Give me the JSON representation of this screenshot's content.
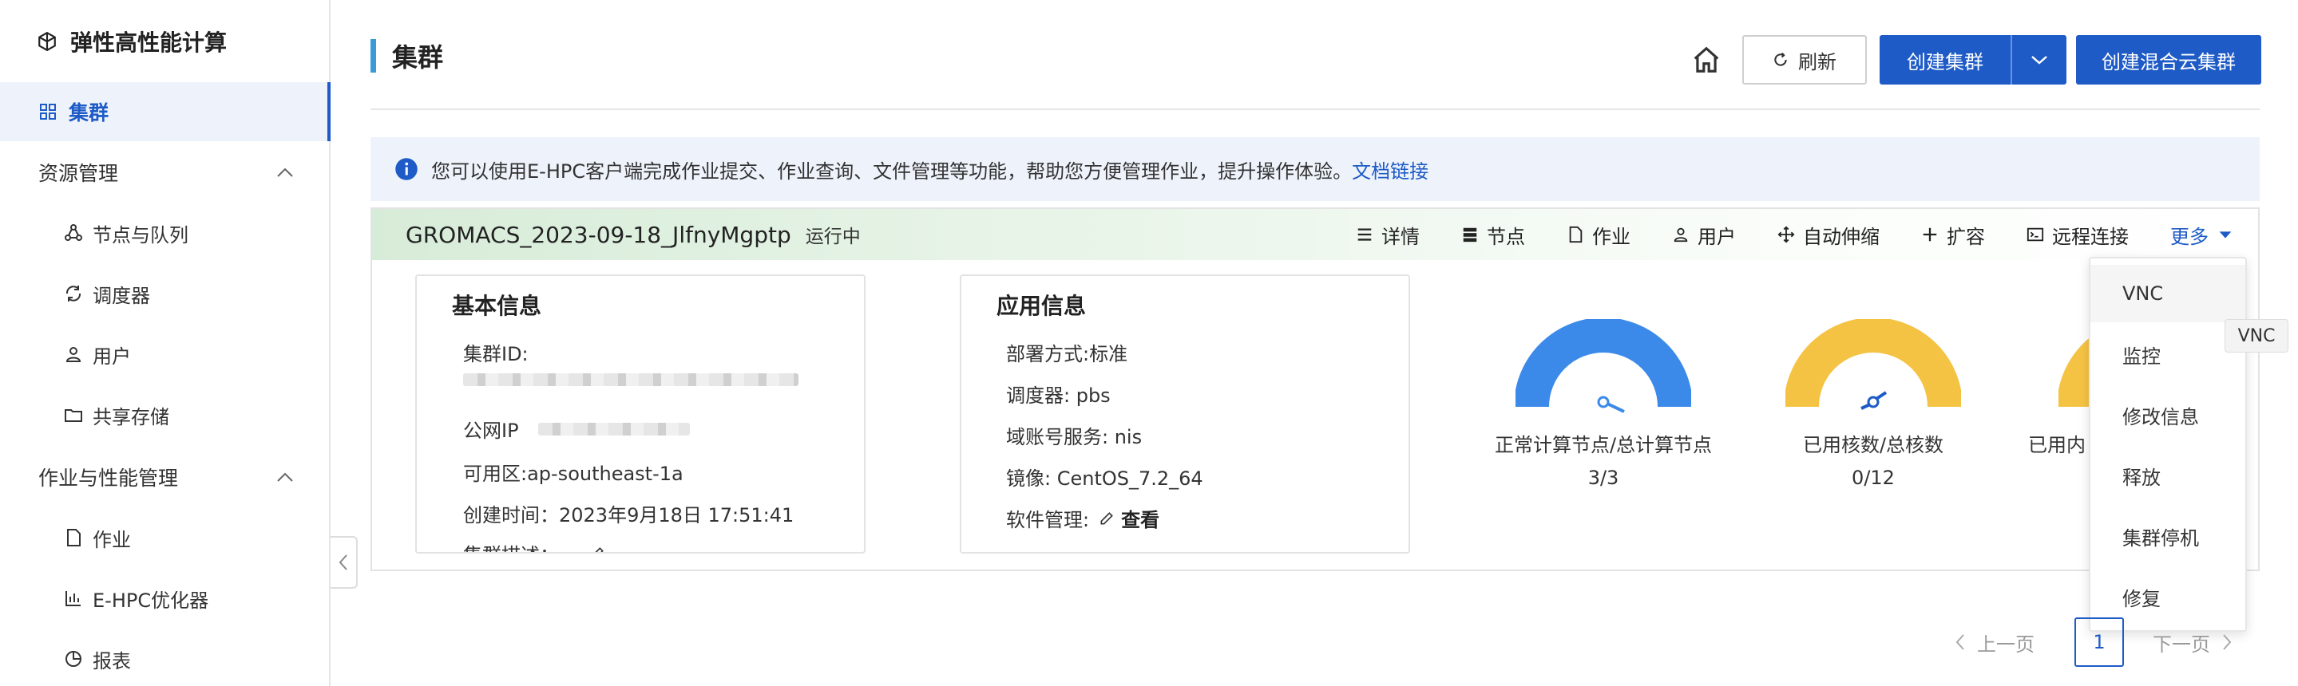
{
  "sidebar": {
    "brand": "弹性高性能计算",
    "active_item": "集群",
    "groups": [
      {
        "label": "资源管理",
        "items": [
          "节点与队列",
          "调度器",
          "用户",
          "共享存储"
        ]
      },
      {
        "label": "作业与性能管理",
        "items": [
          "作业",
          "E-HPC优化器",
          "报表"
        ]
      }
    ]
  },
  "header": {
    "title": "集群",
    "refresh_label": "刷新",
    "create_label": "创建集群",
    "hybrid_label": "创建混合云集群"
  },
  "banner": {
    "text": "您可以使用E-HPC客户端完成作业提交、作业查询、文件管理等功能，帮助您方便管理作业，提升操作体验。",
    "link": "文档链接"
  },
  "cluster": {
    "name": "GROMACS_2023-09-18_JlfnyMgptp",
    "status": "运行中",
    "actions": [
      "详情",
      "节点",
      "作业",
      "用户",
      "自动伸缩",
      "扩容",
      "远程连接",
      "更多"
    ],
    "basic": {
      "title": "基本信息",
      "id_label": "集群ID:",
      "ip_label": "公网IP",
      "zone": "可用区:ap-southeast-1a",
      "created": "创建时间：2023年9月18日 17:51:41",
      "desc": "集群描述："
    },
    "app": {
      "title": "应用信息",
      "deploy": "部署方式:标准",
      "scheduler": "调度器: pbs",
      "domain": "域账号服务: nis",
      "image": "镜像: CentOS_7.2_64",
      "software": "软件管理:",
      "view": "查看"
    },
    "gauges": [
      {
        "label": "正常计算节点/总计算节点",
        "value": "3/3",
        "fraction": 1.0,
        "color": "#3b8aea"
      },
      {
        "label": "已用核数/总核数",
        "value": "0/12",
        "fraction": 0.0,
        "color": "#f5c344"
      },
      {
        "label": "已用内",
        "value": "",
        "fraction": 0.0,
        "color": "#f5c344"
      }
    ]
  },
  "dropdown": {
    "items": [
      "VNC",
      "监控",
      "修改信息",
      "释放",
      "集群停机",
      "修复"
    ],
    "tooltip": "VNC"
  },
  "pagination": {
    "prev": "上一页",
    "current": "1",
    "next": "下一页"
  }
}
